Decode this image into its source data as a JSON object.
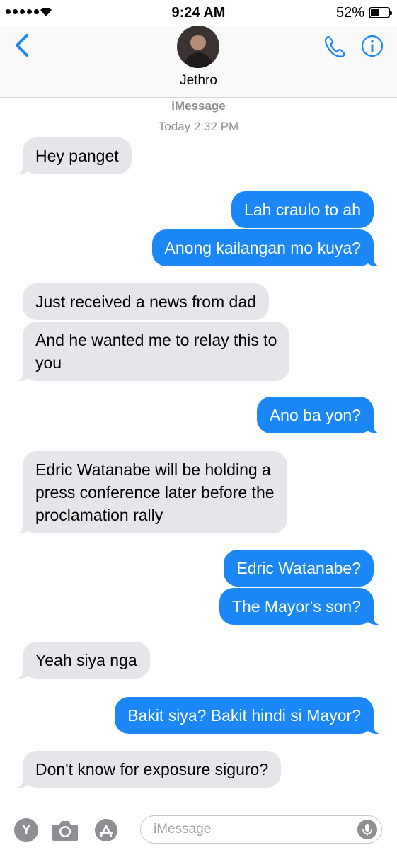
{
  "status_bar": {
    "time": "9:24 AM",
    "battery_percent": "52%",
    "battery_level": 0.52,
    "signal_icon": "signal-dots-icon",
    "wifi_icon": "wifi-icon"
  },
  "header": {
    "back_icon": "chevron-left-icon",
    "contact_name": "Jethro",
    "call_icon": "phone-icon",
    "info_icon": "info-icon"
  },
  "thread": {
    "service": "iMessage",
    "timestamp": "Today 2:32 PM",
    "messages": [
      {
        "from": "them",
        "text": "Hey panget"
      },
      {
        "from": "me",
        "text": "Lah craulo to ah"
      },
      {
        "from": "me",
        "text": "Anong kailangan mo kuya?"
      },
      {
        "from": "them",
        "text": "Just received a news from dad"
      },
      {
        "from": "them",
        "text": "And he wanted me to relay this to\nyou"
      },
      {
        "from": "me",
        "text": "Ano ba yon?"
      },
      {
        "from": "them",
        "text": "Edric Watanabe will be holding a\npress conference later before the\nproclamation rally"
      },
      {
        "from": "me",
        "text": "Edric Watanabe?"
      },
      {
        "from": "me",
        "text": "The Mayor's son?"
      },
      {
        "from": "them",
        "text": "Yeah siya nga"
      },
      {
        "from": "me",
        "text": "Bakit siya? Bakit hindi si Mayor?"
      },
      {
        "from": "them",
        "text": "Don't know for exposure siguro?"
      }
    ]
  },
  "input_bar": {
    "app_y_label": "Y",
    "camera_icon": "camera-icon",
    "appstore_icon": "app-store-icon",
    "placeholder": "iMessage",
    "mic_icon": "microphone-icon"
  },
  "colors": {
    "outgoing_bubble": "#1b87f6",
    "incoming_bubble": "#e5e5ea",
    "accent": "#1b87f6"
  }
}
